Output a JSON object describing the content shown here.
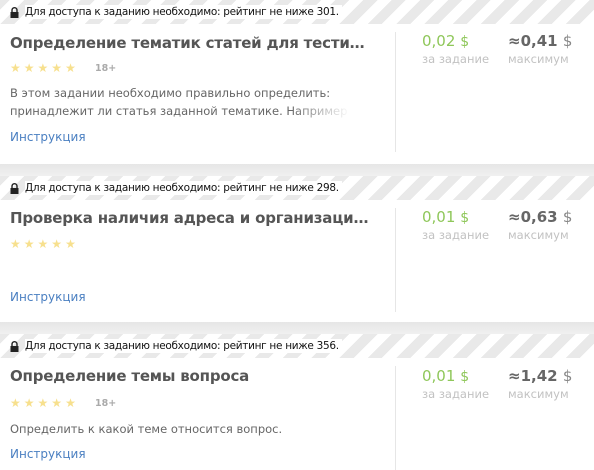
{
  "tasks": [
    {
      "lock_text": "Для доступа к заданию необходимо: рейтинг не ниже 301.",
      "title": "Определение тематик статей для тестирова...",
      "age": "18+",
      "description": "В этом задании необходимо правильно определить: принадлежит ли статья заданной тематике. Например",
      "instruction": "Инструкция",
      "price": "0,02",
      "price_currency": "$",
      "price_label": "за задание",
      "max_approx": "≈",
      "max_price": "0,41",
      "max_currency": "$",
      "max_label": "максимум"
    },
    {
      "lock_text": "Для доступа к заданию необходимо: рейтинг не ниже 298.",
      "title": "Проверка наличия адреса и организации на...",
      "age": "",
      "description": "",
      "instruction": "Инструкция",
      "price": "0,01",
      "price_currency": "$",
      "price_label": "за задание",
      "max_approx": "≈",
      "max_price": "0,63",
      "max_currency": "$",
      "max_label": "максимум"
    },
    {
      "lock_text": "Для доступа к заданию необходимо: рейтинг не ниже 356.",
      "title": "Определение темы вопроса",
      "age": "18+",
      "description": "Определить к какой теме относится вопрос.",
      "instruction": "Инструкция",
      "price": "0,01",
      "price_currency": "$",
      "price_label": "за задание",
      "max_approx": "≈",
      "max_price": "1,42",
      "max_currency": "$",
      "max_label": "максимум"
    }
  ],
  "colors": {
    "price_green": "#8fc75a",
    "link_blue": "#4a7fc1",
    "star_yellow": "#f7e08e"
  },
  "icons": {
    "lock": "lock-icon",
    "star": "star-icon"
  }
}
